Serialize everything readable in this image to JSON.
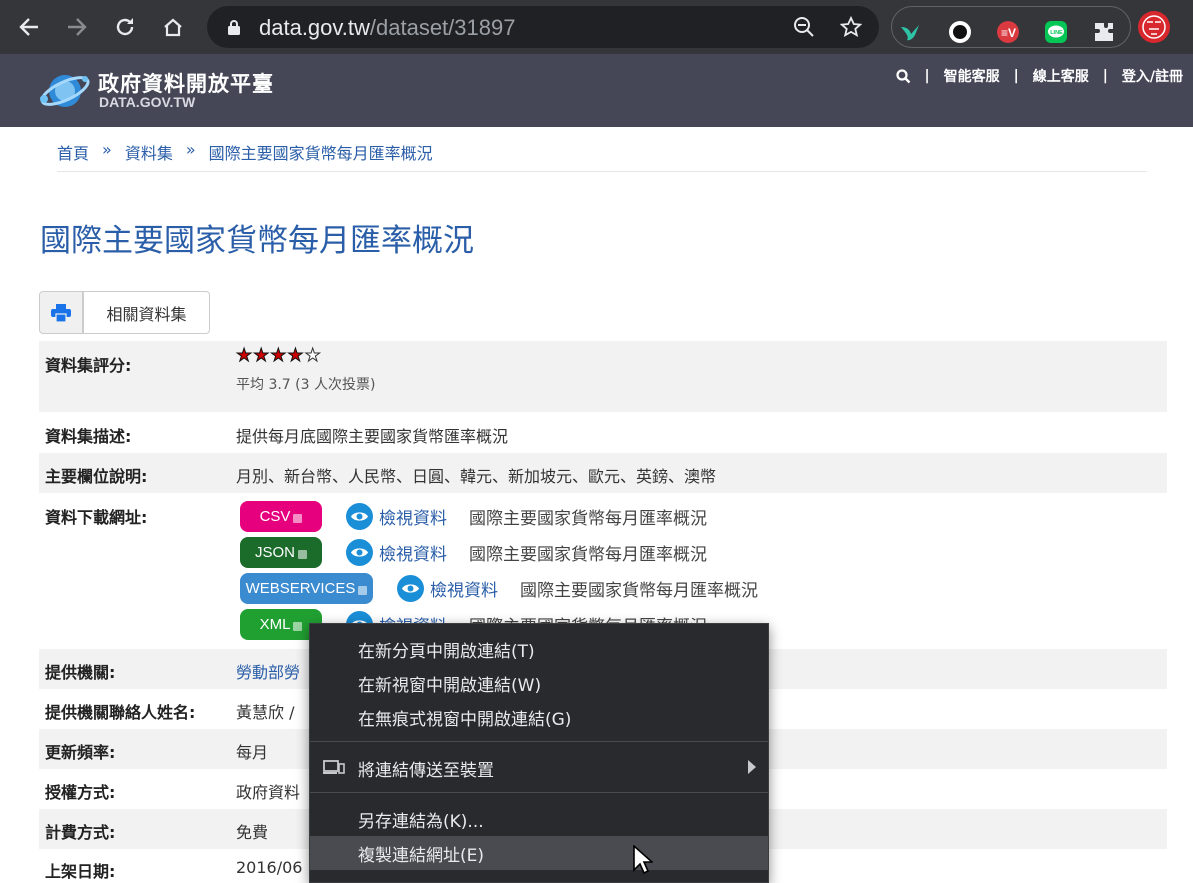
{
  "browser": {
    "url_host": "data.gov.tw",
    "url_path": "/dataset/31897"
  },
  "site": {
    "logo_cn": "政府資料開放平臺",
    "logo_en": "DATA.GOV.TW",
    "nav": [
      "智能客服",
      "線上客服",
      "登入/註冊"
    ],
    "nav_sep": "|"
  },
  "breadcrumb": {
    "items": [
      "首頁",
      "資料集",
      "國際主要國家貨幣每月匯率概況"
    ],
    "sep": "»"
  },
  "page_title": "國際主要國家貨幣每月匯率概況",
  "related_button": "相關資料集",
  "rating": {
    "label": "資料集評分:",
    "stars_filled": 4,
    "stars_total": 5,
    "avg_text": "平均 3.7 (3 人次投票)"
  },
  "description": {
    "label": "資料集描述:",
    "value": "提供每月底國際主要國家貨幣匯率概況"
  },
  "fields": {
    "label": "主要欄位說明:",
    "value": "月別、新台幣、人民幣、日圓、韓元、新加坡元、歐元、英鎊、澳幣"
  },
  "download": {
    "label": "資料下載網址:",
    "view_label": "檢視資料",
    "items": [
      {
        "format": "CSV",
        "color": "#e6007e",
        "name": "國際主要國家貨幣每月匯率概況"
      },
      {
        "format": "JSON",
        "color": "#1b6b2a",
        "name": "國際主要國家貨幣每月匯率概況"
      },
      {
        "format": "WEBSERVICES",
        "color": "#3b8bd0",
        "name": "國際主要國家貨幣每月匯率概況"
      },
      {
        "format": "XML",
        "color": "#21a032",
        "name": "國際主要國家貨幣每月匯率概況"
      }
    ]
  },
  "provider": {
    "label": "提供機關:",
    "value": "勞動部勞"
  },
  "contact": {
    "label": "提供機關聯絡人姓名:",
    "value": "黃慧欣 /"
  },
  "frequency": {
    "label": "更新頻率:",
    "value": "每月"
  },
  "license": {
    "label": "授權方式:",
    "value": "政府資料"
  },
  "fee": {
    "label": "計費方式:",
    "value": "免費"
  },
  "listed": {
    "label": "上架日期:",
    "value": "2016/06"
  },
  "context_menu": {
    "items": [
      "在新分頁中開啟連結(T)",
      "在新視窗中開啟連結(W)",
      "在無痕式視窗中開啟連結(G)",
      "將連結傳送至裝置",
      "另存連結為(K)...",
      "複製連結網址(E)"
    ],
    "highlighted_index": 5
  }
}
